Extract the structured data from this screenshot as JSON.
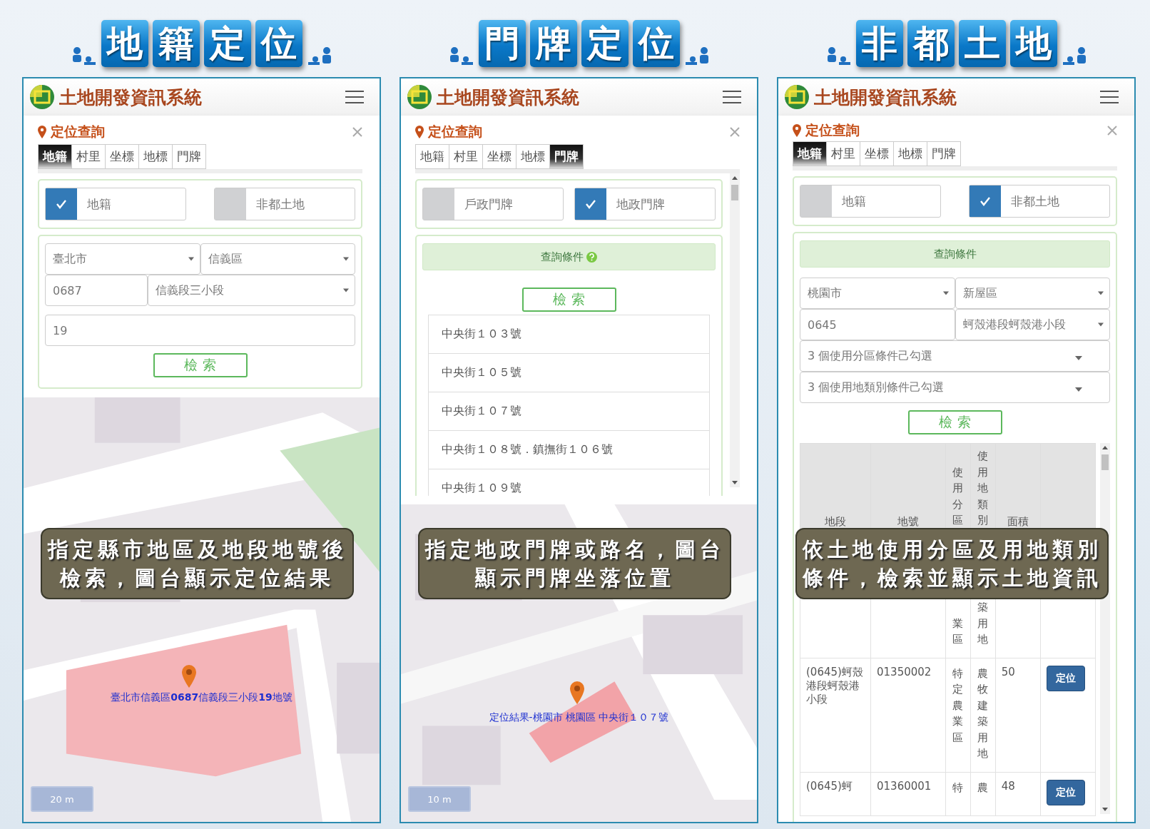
{
  "panels": [
    {
      "heading": [
        "地",
        "籍",
        "定",
        "位"
      ],
      "app_title": "土地開發資訊系統",
      "query_title": "定位查詢",
      "tabs": [
        {
          "label": "地籍",
          "selected": true
        },
        {
          "label": "村里",
          "selected": false
        },
        {
          "label": "坐標",
          "selected": false
        },
        {
          "label": "地標",
          "selected": false
        },
        {
          "label": "門牌",
          "selected": false
        }
      ],
      "toggles": [
        {
          "label": "地籍",
          "checked": true
        },
        {
          "label": "非都土地",
          "checked": false
        }
      ],
      "field_rows": [
        [
          {
            "kind": "select",
            "value": "臺北市"
          },
          {
            "kind": "select",
            "value": "信義區"
          }
        ],
        [
          {
            "kind": "input",
            "value": "0687"
          },
          {
            "kind": "select",
            "value": "信義段三小段"
          }
        ],
        [
          {
            "kind": "input",
            "value": "19"
          }
        ]
      ],
      "search_button": "檢 索",
      "map": {
        "result_label": "臺北市信義區**0687**信義段三小段**19**地號",
        "scale": "20 m"
      },
      "caption": [
        "指定縣市地區及地段地號後",
        "檢索，圖台顯示定位結果"
      ]
    },
    {
      "heading": [
        "門",
        "牌",
        "定",
        "位"
      ],
      "app_title": "土地開發資訊系統",
      "query_title": "定位查詢",
      "tabs": [
        {
          "label": "地籍",
          "selected": false
        },
        {
          "label": "村里",
          "selected": false
        },
        {
          "label": "坐標",
          "selected": false
        },
        {
          "label": "地標",
          "selected": false
        },
        {
          "label": "門牌",
          "selected": true
        }
      ],
      "toggles": [
        {
          "label": "戶政門牌",
          "checked": false
        },
        {
          "label": "地政門牌",
          "checked": true
        }
      ],
      "criteria": {
        "label": "查詢條件",
        "help": true
      },
      "search_button": "檢 索",
      "results": [
        "中央街１０３號",
        "中央街１０５號",
        "中央街１０７號",
        "中央街１０８號．鎮撫街１０６號",
        "中央街１０９號"
      ],
      "map": {
        "result_label": "定位結果-桃園市 桃園區 中央街１０７號",
        "scale": "10 m"
      },
      "caption": [
        "指定地政門牌或路名，圖台",
        "顯示門牌坐落位置"
      ]
    },
    {
      "heading": [
        "非",
        "都",
        "土",
        "地"
      ],
      "app_title": "土地開發資訊系統",
      "query_title": "定位查詢",
      "tabs": [
        {
          "label": "地籍",
          "selected": true
        },
        {
          "label": "村里",
          "selected": false
        },
        {
          "label": "坐標",
          "selected": false
        },
        {
          "label": "地標",
          "selected": false
        },
        {
          "label": "門牌",
          "selected": false
        }
      ],
      "toggles": [
        {
          "label": "地籍",
          "checked": false
        },
        {
          "label": "非都土地",
          "checked": true
        }
      ],
      "criteria": {
        "label": "查詢條件",
        "help": false
      },
      "field_rows": [
        [
          {
            "kind": "select",
            "value": "桃園市"
          },
          {
            "kind": "select",
            "value": "新屋區"
          }
        ],
        [
          {
            "kind": "input",
            "value": "0645"
          },
          {
            "kind": "select",
            "value": "蚵殼港段蚵殼港小段"
          }
        ],
        [
          {
            "kind": "multiselect",
            "value": "3 個使用分區條件己勾選"
          }
        ],
        [
          {
            "kind": "multiselect",
            "value": "3 個使用地類別條件己勾選"
          }
        ]
      ],
      "search_button": "檢 索",
      "table": {
        "columns": [
          "地段",
          "地號",
          "使用分區",
          "使用地類別",
          "面積"
        ],
        "rows": [
          {
            "cells": [
              null,
              null,
              "業區",
              "築用地",
              null
            ]
          },
          {
            "cells": [
              "(0645)蚵殼港段蚵殼港小段",
              "01350002",
              "特定農業區",
              "農牧建築用地",
              "50"
            ],
            "button": "定位"
          },
          {
            "cells": [
              "(0645)蚵",
              "01360001",
              "特",
              "農",
              "48"
            ],
            "button": "定位"
          }
        ]
      },
      "caption": [
        "依土地使用分區及用地類別",
        "條件，檢索並顯示土地資訊"
      ]
    }
  ]
}
